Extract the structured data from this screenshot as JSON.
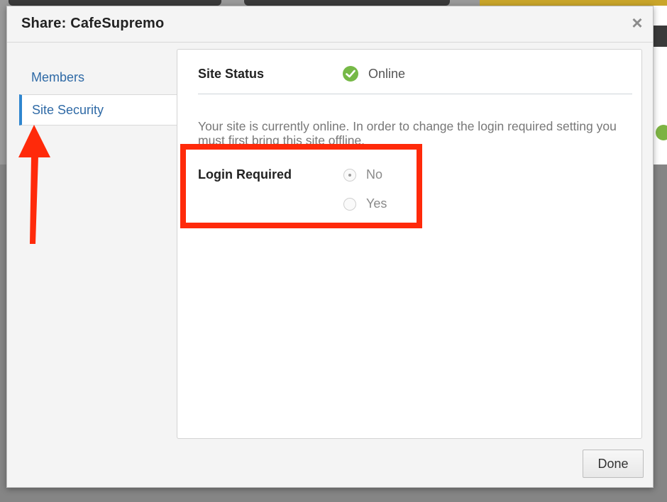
{
  "dialog": {
    "title": "Share: CafeSupremo",
    "close_label": "×"
  },
  "sidebar": {
    "items": [
      {
        "label": "Members",
        "active": false
      },
      {
        "label": "Site Security",
        "active": true
      }
    ]
  },
  "site_status": {
    "label": "Site Status",
    "value": "Online",
    "icon": "check-circle-icon",
    "color": "#76b947"
  },
  "description": "Your site is currently online. In order to change the login required setting you must first bring this site offline.",
  "login_required": {
    "label": "Login Required",
    "options": [
      {
        "label": "No",
        "selected": true,
        "disabled": true
      },
      {
        "label": "Yes",
        "selected": false,
        "disabled": true
      }
    ]
  },
  "footer": {
    "done_label": "Done"
  },
  "annotations": {
    "highlight_color": "#ff2a0a",
    "arrow_color": "#ff2a0a"
  }
}
